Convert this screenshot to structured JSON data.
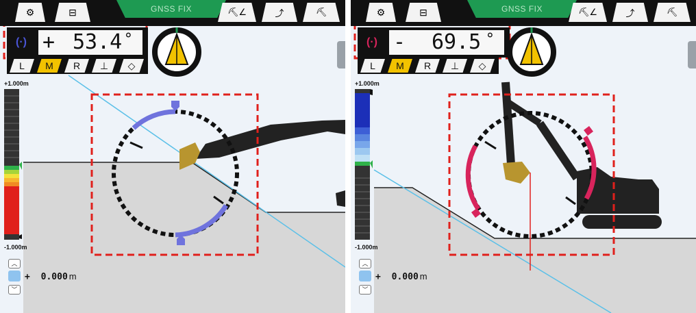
{
  "panels": [
    {
      "id": "left",
      "gnss_label": "GNSS FIX",
      "angle_sign": "+",
      "angle_value": "53.4",
      "angle_unit": "°",
      "angle_icon_color": "#4a55d6",
      "modes": [
        "L",
        "M",
        "R"
      ],
      "active_mode": "M",
      "depth_top_label": "+1.000m",
      "depth_bottom_label": "-1.000m",
      "offset_sign": "+",
      "offset_value": "0.000",
      "offset_unit": "m",
      "arc_color": "#6f73dd"
    },
    {
      "id": "right",
      "gnss_label": "GNSS FIX",
      "angle_sign": "-",
      "angle_value": "69.5",
      "angle_unit": "°",
      "angle_icon_color": "#d8245c",
      "modes": [
        "L",
        "M",
        "R"
      ],
      "active_mode": "M",
      "depth_top_label": "+1.000m",
      "depth_bottom_label": "-1.000m",
      "offset_sign": "+",
      "offset_value": "0.000",
      "offset_unit": "m",
      "arc_color": "#d8245c"
    }
  ],
  "colors": {
    "top_bar": "#111111",
    "gnss_fix": "#1e9a52",
    "highlight_box": "#e0201c",
    "design_line": "#5bc0e8",
    "bucket": "#b8952f",
    "ground": "#d7d7d7",
    "sky": "#eef3f9"
  },
  "icons": {
    "settings": "gear-icon",
    "layout": "split-view-icon",
    "excavator_views": [
      "excavator-angle-icon",
      "excavator-bucket-icon",
      "excavator-side-icon"
    ],
    "mode_extra": [
      "level-target-icon",
      "3d-cube-icon"
    ],
    "offset": "bucket-offset-icon",
    "up": "chevron-up-icon",
    "down": "chevron-down-icon"
  }
}
